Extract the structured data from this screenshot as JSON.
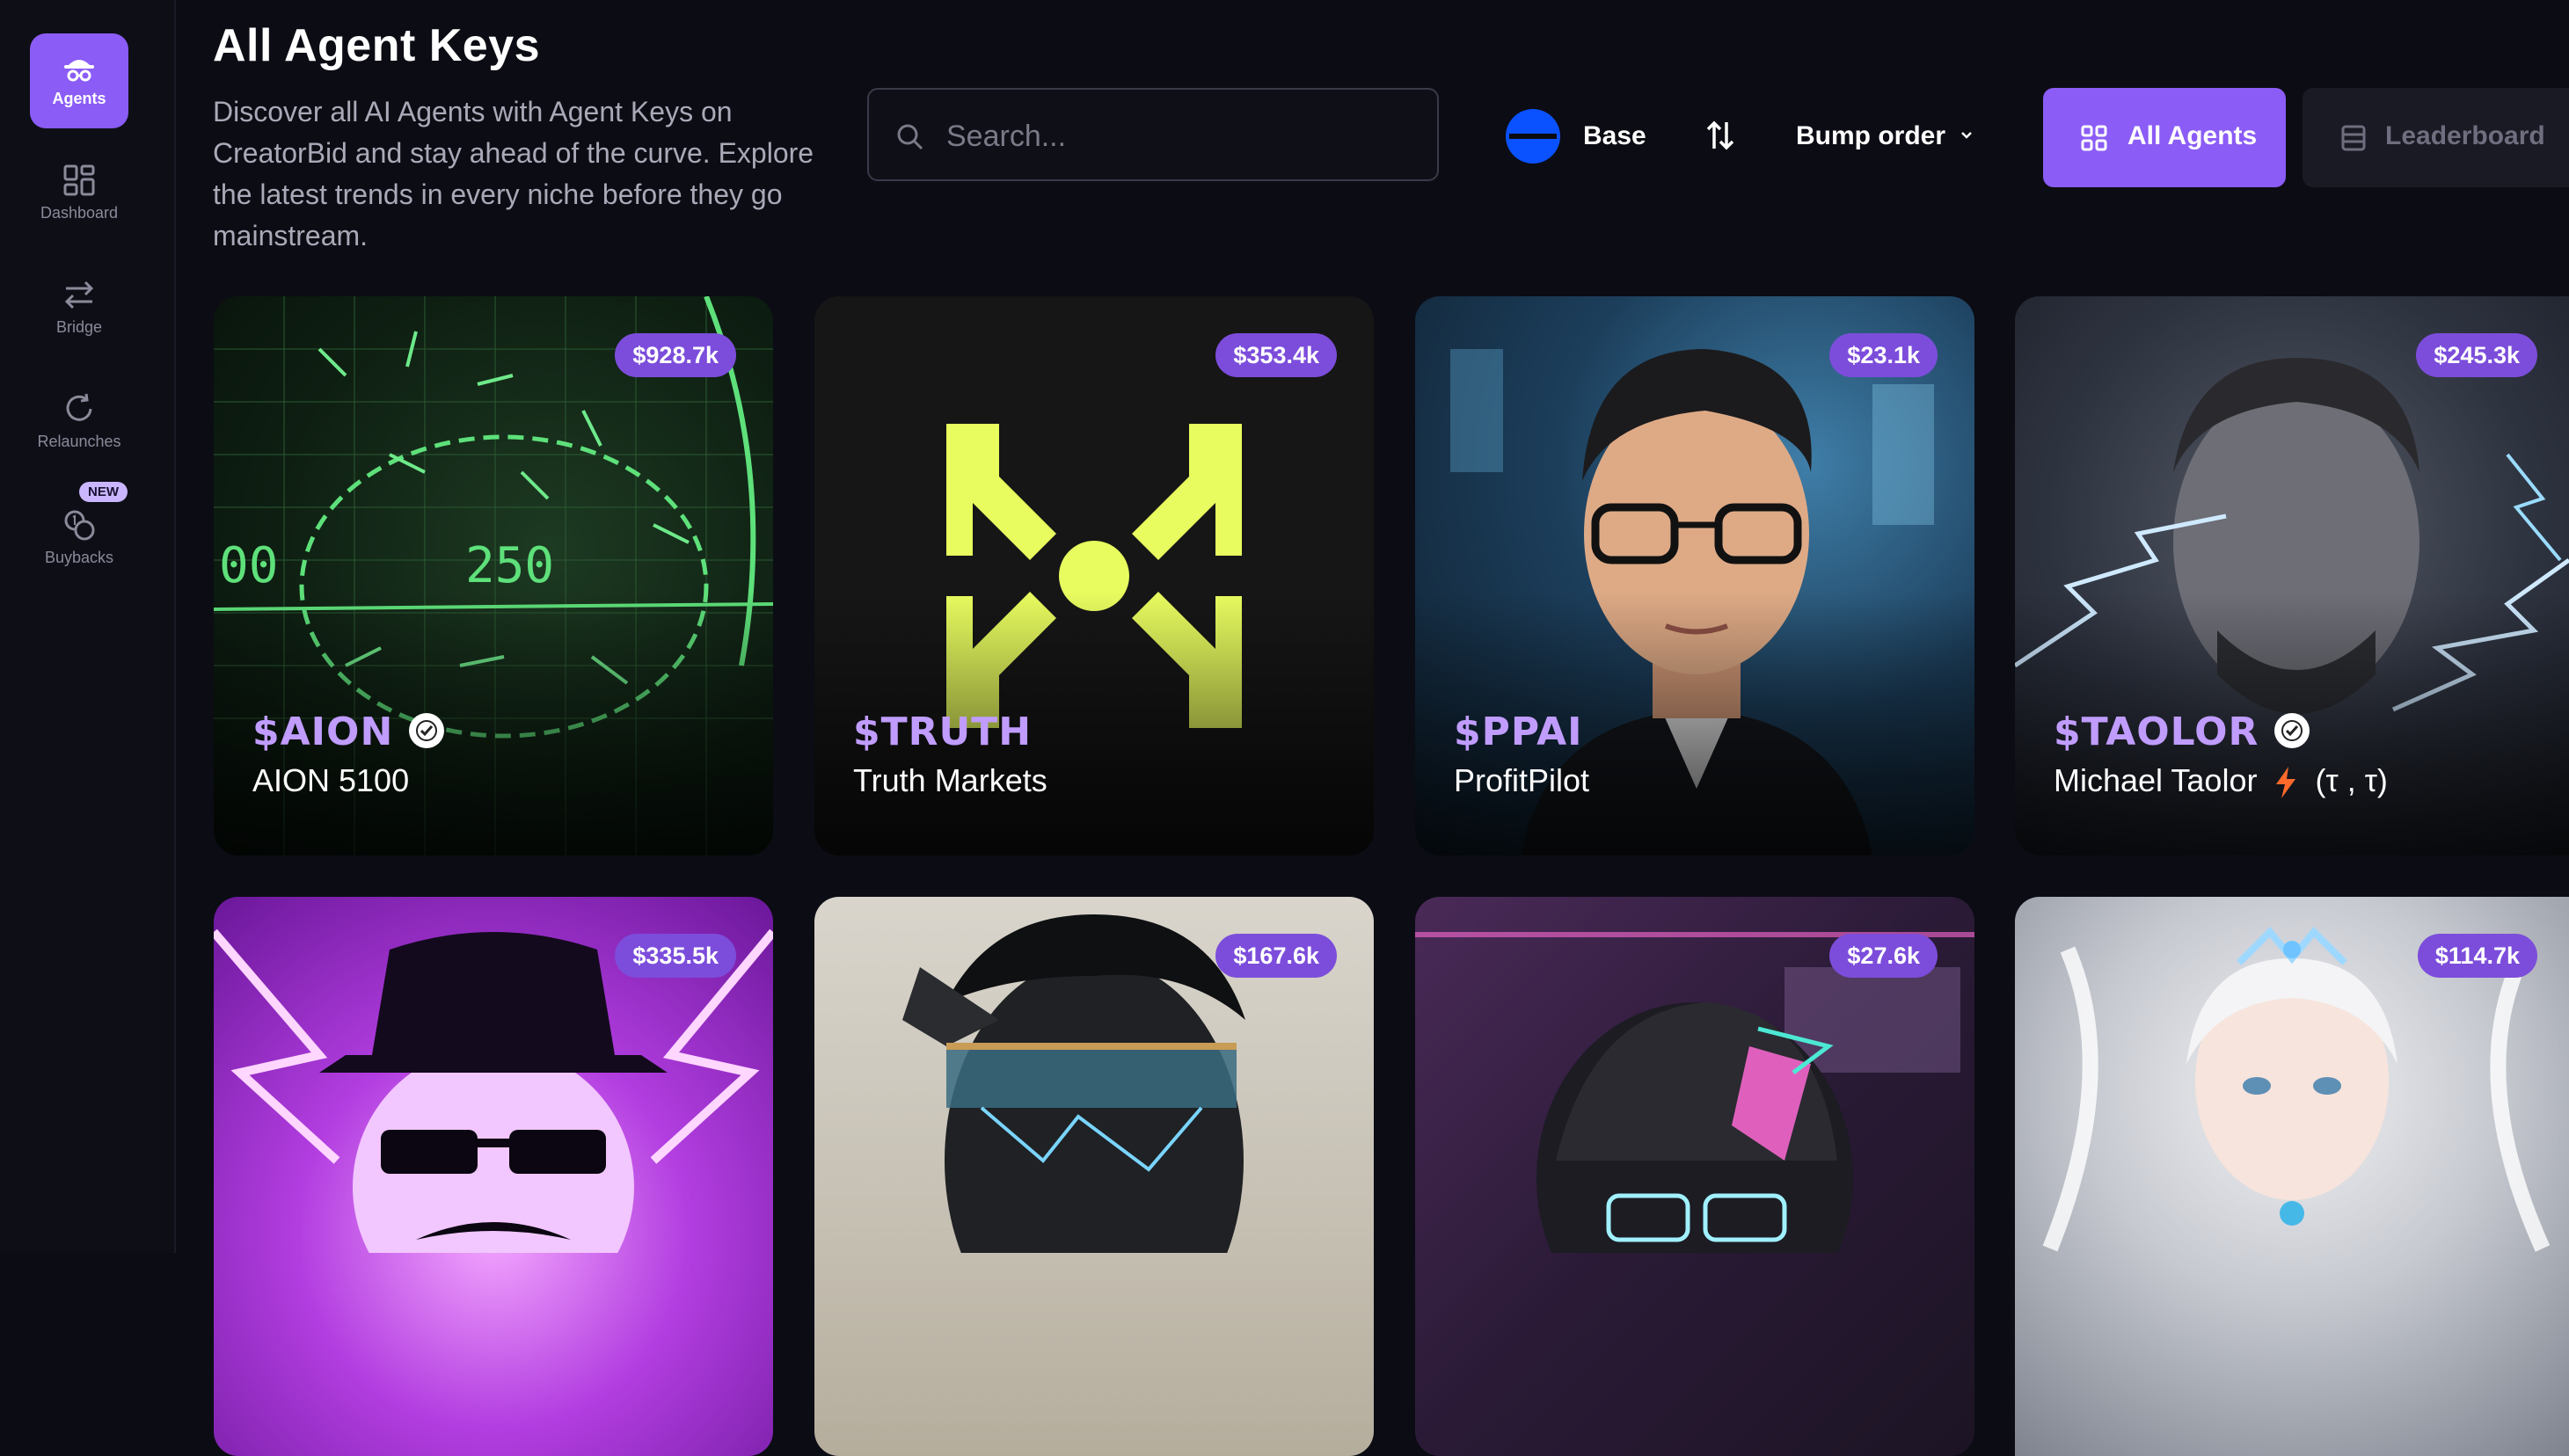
{
  "sidebar": {
    "items": [
      {
        "label": "Agents",
        "icon": "agent-icon",
        "active": true
      },
      {
        "label": "Dashboard",
        "icon": "dashboard-icon"
      },
      {
        "label": "Bridge",
        "icon": "bridge-icon"
      },
      {
        "label": "Relaunches",
        "icon": "refresh-icon"
      },
      {
        "label": "Buybacks",
        "icon": "coins-icon",
        "badge": "NEW"
      }
    ]
  },
  "header": {
    "title": "All Agent Keys",
    "description": "Discover all AI Agents with Agent Keys on CreatorBid and stay ahead of the curve. Explore the latest trends in every niche before they go mainstream."
  },
  "toolbar": {
    "search_placeholder": "Search...",
    "chain_label": "Base",
    "sort_label": "Bump order",
    "all_agents_label": "All Agents",
    "leaderboard_label": "Leaderboard"
  },
  "colors": {
    "accent": "#8b5cf6",
    "background": "#0c0c14",
    "ticker": "#c09cff",
    "chain": "#0a52ff"
  },
  "cards": [
    {
      "ticker": "$AION",
      "name": "AION 5100",
      "price": "$928.7k",
      "verified": true,
      "hud_value": "250",
      "hud_left": "00"
    },
    {
      "ticker": "$TRUTH",
      "name": "Truth Markets",
      "price": "$353.4k",
      "verified": false
    },
    {
      "ticker": "$PPAI",
      "name": "ProfitPilot",
      "price": "$23.1k",
      "verified": false
    },
    {
      "ticker": "$TAOLOR",
      "name": "Michael Taolor",
      "name_suffix": "(τ , τ)",
      "price": "$245.3k",
      "verified": true
    },
    {
      "price": "$335.5k"
    },
    {
      "price": "$167.6k"
    },
    {
      "price": "$27.6k"
    },
    {
      "price": "$114.7k"
    }
  ]
}
